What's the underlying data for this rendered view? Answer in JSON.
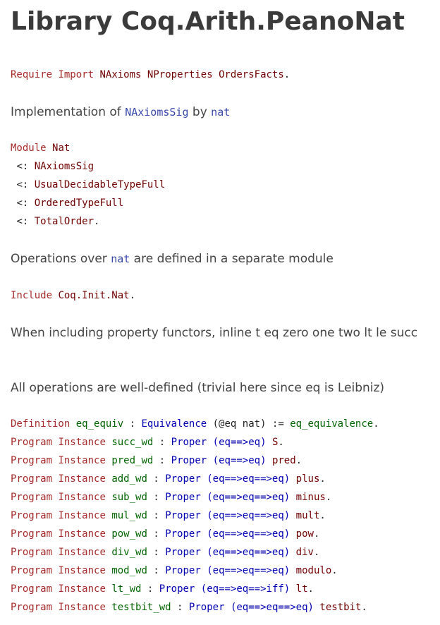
{
  "page_title": "Library Coq.Arith.PeanoNat",
  "require_line": {
    "kw1": "Require",
    "kw2": "Import",
    "mods": [
      "NAxioms",
      "NProperties",
      "OrdersFacts"
    ],
    "end": "."
  },
  "impl_text": {
    "prefix": "Implementation of ",
    "sig": "NAxiomsSig",
    "middle": " by ",
    "type": "nat"
  },
  "module_block": {
    "kw": "Module",
    "name": "Nat",
    "subtype_marker": "<:",
    "subtypes": [
      "NAxiomsSig",
      "UsualDecidableTypeFull",
      "OrderedTypeFull",
      "TotalOrder"
    ],
    "end": "."
  },
  "ops_text": {
    "prefix": "Operations over ",
    "type": "nat",
    "suffix": " are defined in a separate module"
  },
  "include_line": {
    "kw": "Include",
    "mod": "Coq.Init.Nat",
    "end": "."
  },
  "inline_text": "When including property functors, inline t eq zero one two lt le succ",
  "welldef_text": "All operations are well-defined (trivial here since eq is Leibniz)",
  "definition_line": {
    "kw": "Definition",
    "name": "eq_equiv",
    "colon": " : ",
    "type": "Equivalence",
    "args": "(@eq nat)",
    "assign": " := ",
    "value": "eq_equivalence",
    "end": "."
  },
  "instances": [
    {
      "kw1": "Program",
      "kw2": "Instance",
      "name": "succ_wd",
      "type": "Proper",
      "sig": "(eq==>eq)",
      "fn": "S"
    },
    {
      "kw1": "Program",
      "kw2": "Instance",
      "name": "pred_wd",
      "type": "Proper",
      "sig": "(eq==>eq)",
      "fn": "pred"
    },
    {
      "kw1": "Program",
      "kw2": "Instance",
      "name": "add_wd",
      "type": "Proper",
      "sig": "(eq==>eq==>eq)",
      "fn": "plus"
    },
    {
      "kw1": "Program",
      "kw2": "Instance",
      "name": "sub_wd",
      "type": "Proper",
      "sig": "(eq==>eq==>eq)",
      "fn": "minus"
    },
    {
      "kw1": "Program",
      "kw2": "Instance",
      "name": "mul_wd",
      "type": "Proper",
      "sig": "(eq==>eq==>eq)",
      "fn": "mult"
    },
    {
      "kw1": "Program",
      "kw2": "Instance",
      "name": "pow_wd",
      "type": "Proper",
      "sig": "(eq==>eq==>eq)",
      "fn": "pow"
    },
    {
      "kw1": "Program",
      "kw2": "Instance",
      "name": "div_wd",
      "type": "Proper",
      "sig": "(eq==>eq==>eq)",
      "fn": "div"
    },
    {
      "kw1": "Program",
      "kw2": "Instance",
      "name": "mod_wd",
      "type": "Proper",
      "sig": "(eq==>eq==>eq)",
      "fn": "modulo"
    },
    {
      "kw1": "Program",
      "kw2": "Instance",
      "name": "lt_wd",
      "type": "Proper",
      "sig": "(eq==>eq==>iff)",
      "fn": "lt"
    },
    {
      "kw1": "Program",
      "kw2": "Instance",
      "name": "testbit_wd",
      "type": "Proper",
      "sig": "(eq==>eq==>eq)",
      "fn": "testbit"
    }
  ],
  "colors": {
    "keyword": "#a52a2a",
    "module": "#700000",
    "definition": "#006400",
    "type": "#0000b3",
    "inline_ref": "#3949ab",
    "prose": "#444444"
  }
}
